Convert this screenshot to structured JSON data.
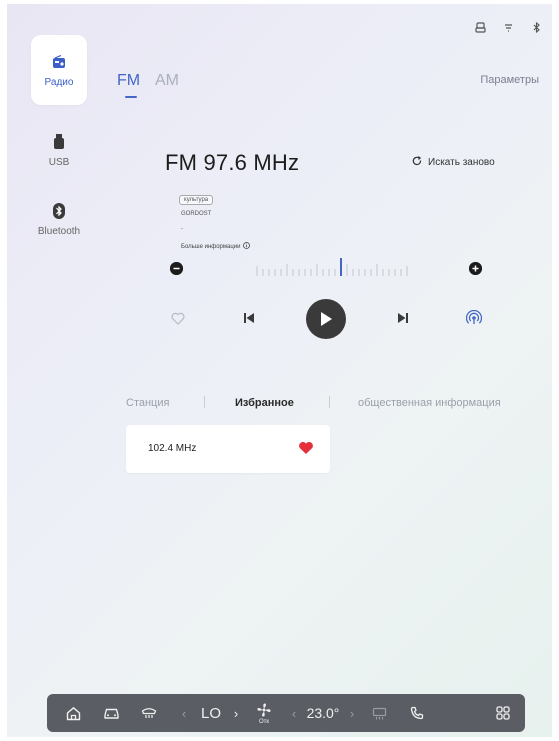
{
  "sidebar": {
    "items": [
      {
        "label": "Радио",
        "icon": "radio-icon",
        "active": true
      },
      {
        "label": "USB",
        "icon": "usb-icon",
        "active": false
      },
      {
        "label": "Bluetooth",
        "icon": "bluetooth-icon",
        "active": false
      }
    ]
  },
  "band_tabs": [
    {
      "label": "FM",
      "active": true
    },
    {
      "label": "AM",
      "active": false
    }
  ],
  "settings_label": "Параметры",
  "station": {
    "frequency": "FM 97.6 MHz",
    "rescan_label": "Искать заново",
    "tag": "культура",
    "rds": "GORDOST",
    "dash": "-",
    "more_info": "Больше информации"
  },
  "list_tabs": [
    {
      "label": "Станция",
      "active": false
    },
    {
      "label": "Избранное",
      "active": true
    },
    {
      "label": "общественная информация",
      "active": false
    }
  ],
  "favorites": [
    {
      "frequency": "102.4  MHz",
      "liked": true
    }
  ],
  "dock": {
    "fan_level": "LO",
    "fan_sub": "Отк",
    "temperature": "23.0°"
  },
  "colors": {
    "accent": "#4466c6",
    "heart": "#e5303b",
    "dock_bg": "#5a5d63"
  }
}
